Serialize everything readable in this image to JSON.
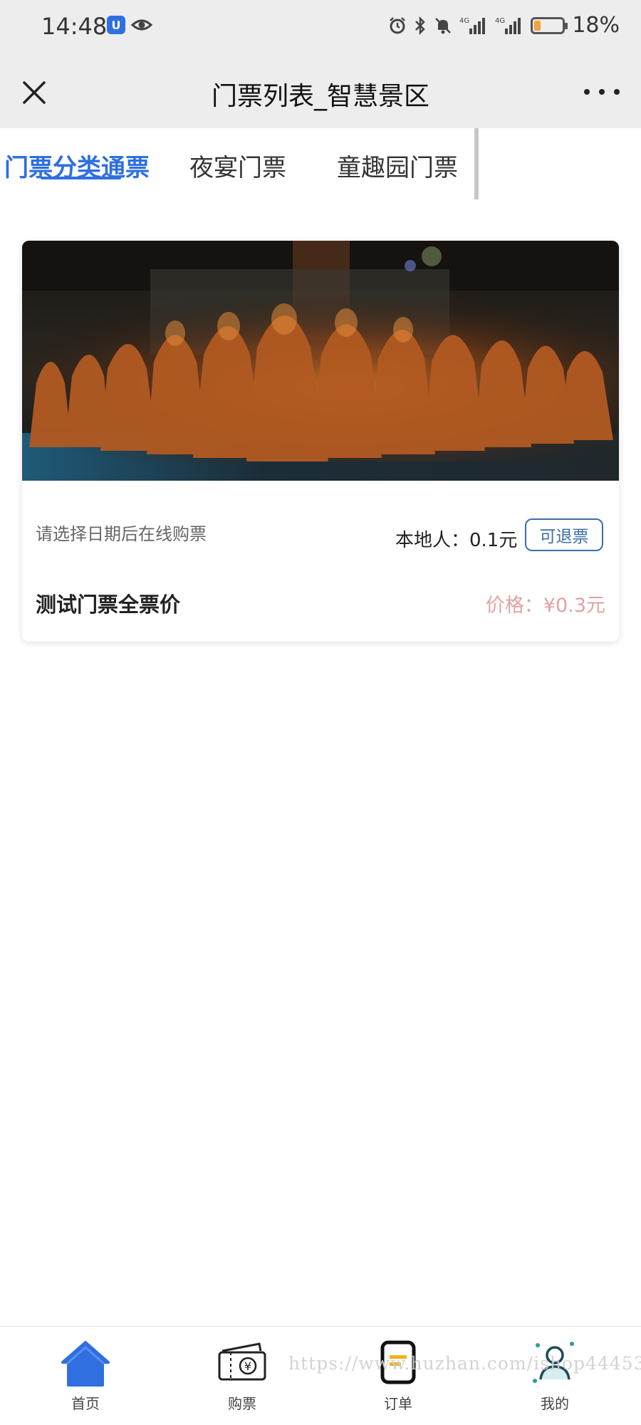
{
  "status_bar": {
    "time": "14:48",
    "battery": "18%",
    "battery_level": 0.18,
    "icons": [
      "app-badge-icon",
      "eye-icon",
      "alarm-icon",
      "bluetooth-icon",
      "mute-icon",
      "signal-4g-icon",
      "signal-4g-icon",
      "battery-icon"
    ]
  },
  "title_bar": {
    "title": "门票列表_智慧景区",
    "close_icon": "close-icon",
    "more_icon": "more-icon"
  },
  "tabs": [
    {
      "label": "门票分类通票",
      "active": true
    },
    {
      "label": "夜宴门票",
      "active": false
    },
    {
      "label": "童趣园门票",
      "active": false
    }
  ],
  "ticket": {
    "image": "scenic-photo (carved wooden arhat statues)",
    "hint": "请选择日期后在线购票",
    "local_price": "本地人：0.1元",
    "refund_badge": "可退票",
    "name": "测试门票全票价",
    "price": "价格：¥0.3元"
  },
  "bottom_nav": [
    {
      "label": "首页",
      "icon": "home-icon",
      "active": true
    },
    {
      "label": "购票",
      "icon": "ticket-icon",
      "active": false
    },
    {
      "label": "订单",
      "icon": "order-icon",
      "active": false
    },
    {
      "label": "我的",
      "icon": "user-icon",
      "active": false
    }
  ],
  "watermark": "https://www.huzhan.com/ishop44453",
  "colors": {
    "accent": "#2f6fe0",
    "price": "#e0a2a2",
    "refund": "#3a6ea8",
    "header_bg": "#ededed"
  }
}
